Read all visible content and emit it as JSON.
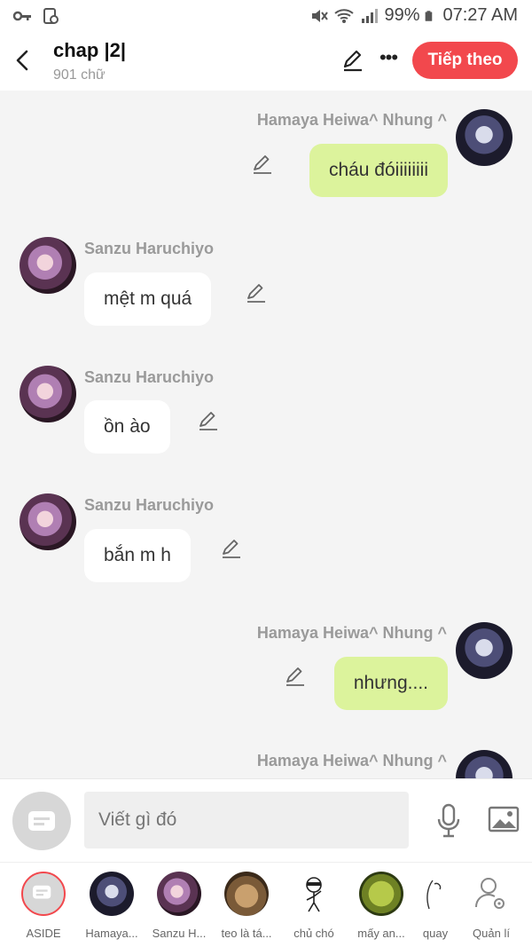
{
  "status": {
    "battery": "99%",
    "time": "07:27 AM",
    "icons": [
      "key-icon",
      "sim-icon",
      "mute-icon",
      "wifi-icon",
      "signal-icon",
      "battery-icon"
    ]
  },
  "header": {
    "title": "chap |2|",
    "subtitle": "901 chữ",
    "next_label": "Tiếp theo",
    "accent": "#f2484d"
  },
  "messages": [
    {
      "side": "right",
      "name": "Hamaya Heiwa^ Nhung ^",
      "text": "cháu đóiiiiiiii"
    },
    {
      "side": "left",
      "name": "Sanzu Haruchiyo",
      "text": "mệt m quá"
    },
    {
      "side": "left",
      "name": "Sanzu Haruchiyo",
      "text": "ồn ào"
    },
    {
      "side": "left",
      "name": "Sanzu Haruchiyo",
      "text": "bắn m h"
    },
    {
      "side": "right",
      "name": "Hamaya Heiwa^ Nhung ^",
      "text": "nhưng...."
    },
    {
      "side": "right",
      "name": "Hamaya Heiwa^ Nhung ^",
      "text": ""
    }
  ],
  "composer": {
    "placeholder": "Viết gì đó"
  },
  "characters": [
    {
      "label": "ASIDE"
    },
    {
      "label": "Hamaya..."
    },
    {
      "label": "Sanzu H..."
    },
    {
      "label": "teo là tá..."
    },
    {
      "label": "chủ chó"
    },
    {
      "label": "mấy an..."
    },
    {
      "label": "quay"
    },
    {
      "label": "Quản lí"
    }
  ],
  "colors": {
    "bubble_right": "#dcf39c",
    "bubble_left": "#ffffff",
    "background": "#f4f4f4"
  }
}
